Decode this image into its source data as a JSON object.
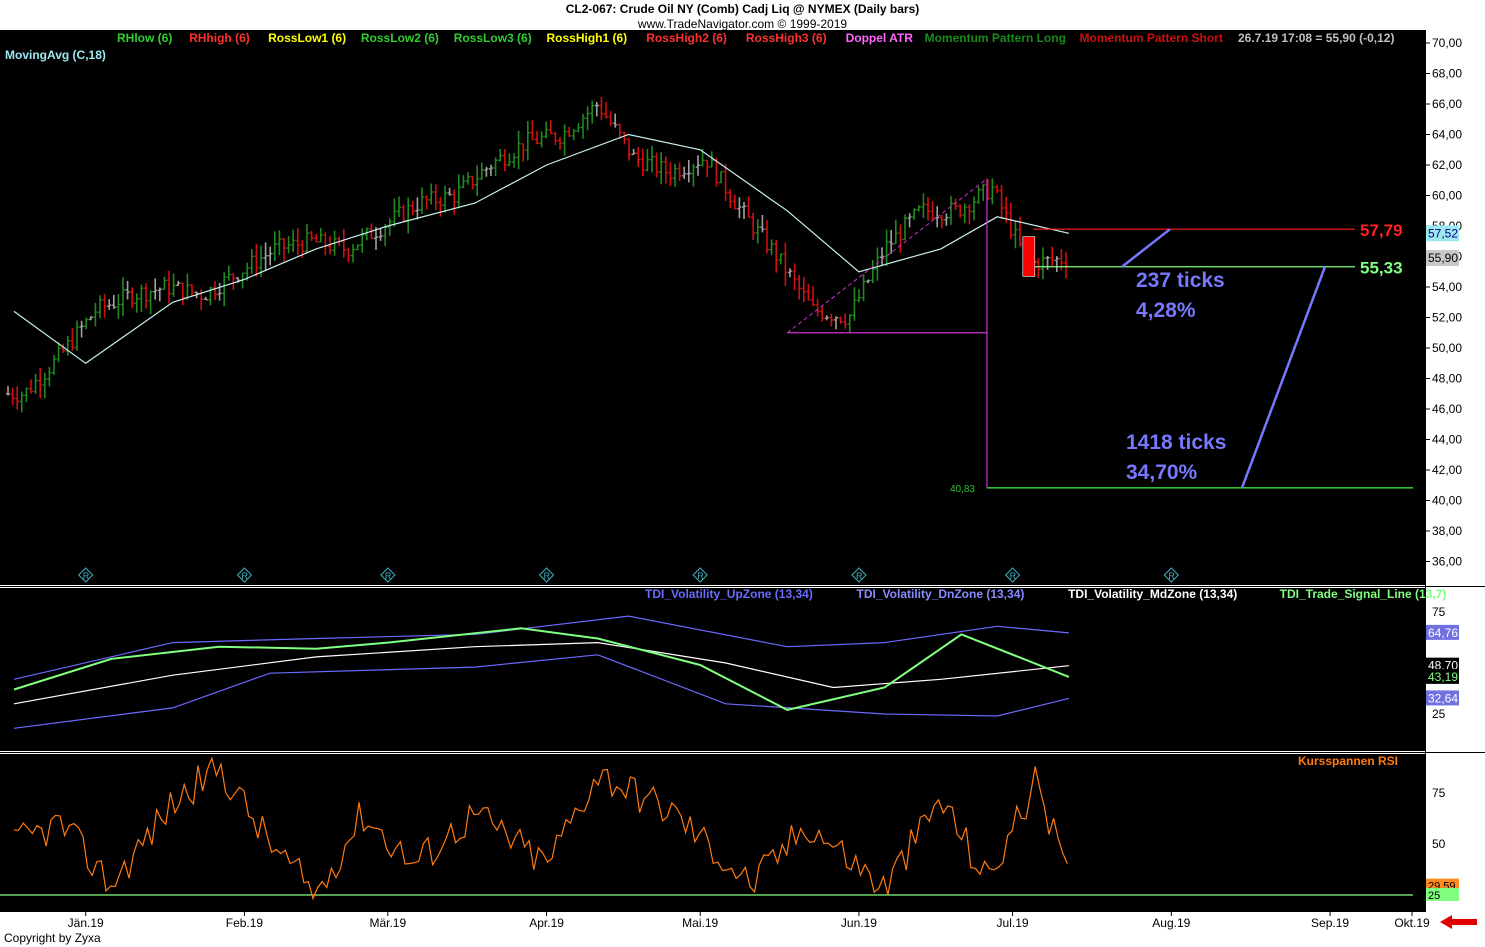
{
  "header": {
    "title": "CL2-067:  Crude Oil NY (Comb) Cadj Liq @ NYMEX  (Daily bars)",
    "subtitle": "www.TradeNavigator.com © 1999-2019"
  },
  "footer": {
    "copyright": "Copyright by Zyxa"
  },
  "colors": {
    "background": "#000000",
    "up_bar": "#1f8a1f",
    "down_bar": "#d01010",
    "neutral_bar": "#a0a0a0",
    "moving_avg": "#c8f0f0",
    "annotation": "#7878ff",
    "upzone": "#6060e0",
    "mdzone": "#ffffff",
    "signal": "#80ff80",
    "rsi": "#ff7a10",
    "level_red": "#ff2020",
    "level_green": "#80ff80",
    "magenta": "#d030d0"
  },
  "main_panel": {
    "legend": [
      {
        "label": "RHlow (6)",
        "color": "#32cd32"
      },
      {
        "label": "RHhigh (6)",
        "color": "#ff3030"
      },
      {
        "label": "RossLow1 (6)",
        "color": "#ffff00"
      },
      {
        "label": "RossLow2 (6)",
        "color": "#32cd32"
      },
      {
        "label": "RossLow3 (6)",
        "color": "#32cd32"
      },
      {
        "label": "RossHigh1 (6)",
        "color": "#ffff00"
      },
      {
        "label": "RossHigh2 (6)",
        "color": "#ff3030"
      },
      {
        "label": "RossHigh3 (6)",
        "color": "#ff3030"
      },
      {
        "label": "Doppel ATR",
        "color": "#ff66ff"
      },
      {
        "label": "Momentum Pattern Long",
        "color": "#1a8a1a"
      },
      {
        "label": "Momentum Pattern Short",
        "color": "#cc1010"
      },
      {
        "label": "26.7.19 17:08 = 55,90 (-0,12)",
        "color": "#c0c0c0"
      }
    ],
    "indicator_label": "MovingAvg (C,18)",
    "y_ticks": [
      "70,00",
      "68,00",
      "66,00",
      "64,00",
      "62,00",
      "60,00",
      "58,00",
      "56,00",
      "54,00",
      "52,00",
      "50,00",
      "48,00",
      "46,00",
      "44,00",
      "42,00",
      "40,00",
      "38,00",
      "36,00"
    ],
    "right_badges": [
      {
        "text": "57,52",
        "value": 57.52,
        "bg": "#9ee8f0",
        "fg": "#000080"
      },
      {
        "text": "55,90",
        "value": 55.9,
        "bg": "#c8c8c8",
        "fg": "#000000"
      }
    ],
    "levels": [
      {
        "label": "57,79",
        "value": 57.79,
        "color": "#ff2020"
      },
      {
        "label": "55,33",
        "value": 55.33,
        "color": "#80ff80"
      },
      {
        "label": "40,83",
        "value": 40.83,
        "color": "#30c030"
      }
    ],
    "annotations": [
      {
        "line1": "237 ticks",
        "line2": "4,28%"
      },
      {
        "line1": "1418 ticks",
        "line2": "34,70%"
      }
    ],
    "report_marker": "R"
  },
  "x_axis": {
    "labels": [
      "Jän.19",
      "Feb.19",
      "Mär.19",
      "Apr.19",
      "Mai.19",
      "Jun.19",
      "Jul.19",
      "Aug.19",
      "Sep.19",
      "Okt.19"
    ]
  },
  "tdi_panel": {
    "legend": [
      {
        "label": "TDI_Volatility_UpZone (13,34)",
        "color": "#6a6aff"
      },
      {
        "label": "TDI_Volatility_DnZone (13,34)",
        "color": "#8a8aff"
      },
      {
        "label": "TDI_Volatility_MdZone (13,34)",
        "color": "#ffffff"
      },
      {
        "label": "TDI_Trade_Signal_Line (13,7)",
        "color": "#80ff80"
      }
    ],
    "y_ticks": [
      "75",
      "25"
    ],
    "badges": [
      {
        "text": "64,76",
        "value": 64.76,
        "bg": "#7070e0",
        "fg": "#ffffff"
      },
      {
        "text": "48,70",
        "value": 48.7,
        "bg": "#000000",
        "fg": "#ffffff"
      },
      {
        "text": "43,19",
        "value": 43.19,
        "bg": "#000000",
        "fg": "#80ff80"
      },
      {
        "text": "32,64",
        "value": 32.64,
        "bg": "#7070e0",
        "fg": "#ffffff"
      }
    ]
  },
  "rsi_panel": {
    "legend": "Kursspannen RSI",
    "y_ticks": [
      "75",
      "50"
    ],
    "badges": [
      {
        "text": "29,59",
        "value": 29.59,
        "bg": "#ff8a20",
        "fg": "#000000"
      },
      {
        "text": "25",
        "value": 25,
        "bg": "#80ff80",
        "fg": "#000000"
      }
    ]
  },
  "chart_data": [
    {
      "type": "candlestick",
      "title": "CL2-067: Crude Oil NY (Comb) Cadj Liq @ NYMEX (Daily bars)",
      "x_label": "",
      "y_label": "",
      "ylim": [
        34.6,
        71.0
      ],
      "x_range": [
        "2019-01-01",
        "2019-10-01"
      ],
      "grid": false,
      "approx_close": [
        {
          "x": "2019-01-03",
          "y": 47.0
        },
        {
          "x": "2019-01-10",
          "y": 49.5
        },
        {
          "x": "2019-01-17",
          "y": 52.5
        },
        {
          "x": "2019-01-24",
          "y": 53.5
        },
        {
          "x": "2019-01-31",
          "y": 54.0
        },
        {
          "x": "2019-02-07",
          "y": 53.5
        },
        {
          "x": "2019-02-14",
          "y": 55.0
        },
        {
          "x": "2019-02-21",
          "y": 56.5
        },
        {
          "x": "2019-02-28",
          "y": 57.0
        },
        {
          "x": "2019-03-07",
          "y": 56.5
        },
        {
          "x": "2019-03-14",
          "y": 58.0
        },
        {
          "x": "2019-03-21",
          "y": 59.5
        },
        {
          "x": "2019-03-28",
          "y": 60.0
        },
        {
          "x": "2019-04-04",
          "y": 62.0
        },
        {
          "x": "2019-04-11",
          "y": 63.5
        },
        {
          "x": "2019-04-18",
          "y": 64.0
        },
        {
          "x": "2019-04-25",
          "y": 66.0
        },
        {
          "x": "2019-05-02",
          "y": 62.5
        },
        {
          "x": "2019-05-09",
          "y": 61.5
        },
        {
          "x": "2019-05-16",
          "y": 62.5
        },
        {
          "x": "2019-05-23",
          "y": 59.0
        },
        {
          "x": "2019-05-30",
          "y": 56.0
        },
        {
          "x": "2019-06-06",
          "y": 52.5
        },
        {
          "x": "2019-06-13",
          "y": 52.0
        },
        {
          "x": "2019-06-20",
          "y": 56.5
        },
        {
          "x": "2019-06-27",
          "y": 59.0
        },
        {
          "x": "2019-07-04",
          "y": 59.0
        },
        {
          "x": "2019-07-11",
          "y": 60.5
        },
        {
          "x": "2019-07-18",
          "y": 55.5
        },
        {
          "x": "2019-07-26",
          "y": 55.9
        }
      ],
      "moving_average_18": [
        {
          "x": "2019-01-01",
          "y": 52.4
        },
        {
          "x": "2019-01-15",
          "y": 49.0
        },
        {
          "x": "2019-02-01",
          "y": 53.0
        },
        {
          "x": "2019-02-15",
          "y": 54.5
        },
        {
          "x": "2019-03-01",
          "y": 56.5
        },
        {
          "x": "2019-03-15",
          "y": 58.0
        },
        {
          "x": "2019-04-01",
          "y": 59.5
        },
        {
          "x": "2019-04-15",
          "y": 62.0
        },
        {
          "x": "2019-05-01",
          "y": 64.0
        },
        {
          "x": "2019-05-15",
          "y": 63.0
        },
        {
          "x": "2019-06-01",
          "y": 59.0
        },
        {
          "x": "2019-06-15",
          "y": 55.0
        },
        {
          "x": "2019-07-01",
          "y": 56.5
        },
        {
          "x": "2019-07-12",
          "y": 58.6
        },
        {
          "x": "2019-07-26",
          "y": 57.52
        }
      ]
    },
    {
      "type": "line",
      "title": "TDI",
      "ylim": [
        15,
        85
      ],
      "series": [
        {
          "name": "TDI_Volatility_UpZone (13,34)",
          "points": [
            {
              "x": "2019-01-01",
              "y": 42
            },
            {
              "x": "2019-02-01",
              "y": 60
            },
            {
              "x": "2019-03-01",
              "y": 62
            },
            {
              "x": "2019-04-01",
              "y": 64
            },
            {
              "x": "2019-05-01",
              "y": 73
            },
            {
              "x": "2019-06-01",
              "y": 58
            },
            {
              "x": "2019-06-20",
              "y": 60
            },
            {
              "x": "2019-07-12",
              "y": 68
            },
            {
              "x": "2019-07-26",
              "y": 64.76
            }
          ]
        },
        {
          "name": "TDI_Volatility_DnZone (13,34)",
          "points": [
            {
              "x": "2019-01-01",
              "y": 18
            },
            {
              "x": "2019-02-01",
              "y": 28
            },
            {
              "x": "2019-02-20",
              "y": 45
            },
            {
              "x": "2019-04-01",
              "y": 48
            },
            {
              "x": "2019-04-25",
              "y": 54
            },
            {
              "x": "2019-05-20",
              "y": 30
            },
            {
              "x": "2019-06-20",
              "y": 25
            },
            {
              "x": "2019-07-12",
              "y": 24
            },
            {
              "x": "2019-07-26",
              "y": 32.64
            }
          ]
        },
        {
          "name": "TDI_Volatility_MdZone (13,34)",
          "points": [
            {
              "x": "2019-01-01",
              "y": 30
            },
            {
              "x": "2019-02-01",
              "y": 44
            },
            {
              "x": "2019-03-01",
              "y": 53
            },
            {
              "x": "2019-04-01",
              "y": 58
            },
            {
              "x": "2019-04-25",
              "y": 60
            },
            {
              "x": "2019-05-20",
              "y": 50
            },
            {
              "x": "2019-06-10",
              "y": 38
            },
            {
              "x": "2019-07-01",
              "y": 42
            },
            {
              "x": "2019-07-26",
              "y": 48.7
            }
          ]
        },
        {
          "name": "TDI_Trade_Signal_Line (13,7)",
          "points": [
            {
              "x": "2019-01-01",
              "y": 37
            },
            {
              "x": "2019-01-20",
              "y": 52
            },
            {
              "x": "2019-02-10",
              "y": 58
            },
            {
              "x": "2019-03-01",
              "y": 57
            },
            {
              "x": "2019-03-15",
              "y": 60
            },
            {
              "x": "2019-04-10",
              "y": 67
            },
            {
              "x": "2019-04-25",
              "y": 62
            },
            {
              "x": "2019-05-15",
              "y": 49
            },
            {
              "x": "2019-06-01",
              "y": 27
            },
            {
              "x": "2019-06-20",
              "y": 38
            },
            {
              "x": "2019-07-05",
              "y": 64
            },
            {
              "x": "2019-07-26",
              "y": 43.19
            }
          ]
        }
      ]
    },
    {
      "type": "line",
      "title": "Kursspannen RSI",
      "ylim": [
        10,
        98
      ],
      "series": [
        {
          "name": "Kursspannen RSI",
          "points": [
            {
              "x": "2019-01-01",
              "y": 50
            },
            {
              "x": "2019-01-10",
              "y": 60
            },
            {
              "x": "2019-01-20",
              "y": 30
            },
            {
              "x": "2019-02-01",
              "y": 70
            },
            {
              "x": "2019-02-10",
              "y": 88
            },
            {
              "x": "2019-02-20",
              "y": 50
            },
            {
              "x": "2019-03-01",
              "y": 25
            },
            {
              "x": "2019-03-10",
              "y": 65
            },
            {
              "x": "2019-03-20",
              "y": 40
            },
            {
              "x": "2019-04-01",
              "y": 65
            },
            {
              "x": "2019-04-15",
              "y": 40
            },
            {
              "x": "2019-04-25",
              "y": 85
            },
            {
              "x": "2019-05-10",
              "y": 65
            },
            {
              "x": "2019-05-25",
              "y": 30
            },
            {
              "x": "2019-06-05",
              "y": 60
            },
            {
              "x": "2019-06-20",
              "y": 28
            },
            {
              "x": "2019-07-01",
              "y": 72
            },
            {
              "x": "2019-07-10",
              "y": 32
            },
            {
              "x": "2019-07-20",
              "y": 82
            },
            {
              "x": "2019-07-26",
              "y": 29.59
            }
          ]
        },
        {
          "name": "25",
          "points": [
            {
              "x": "2019-01-01",
              "y": 25
            },
            {
              "x": "2019-10-01",
              "y": 25
            }
          ]
        }
      ]
    }
  ]
}
